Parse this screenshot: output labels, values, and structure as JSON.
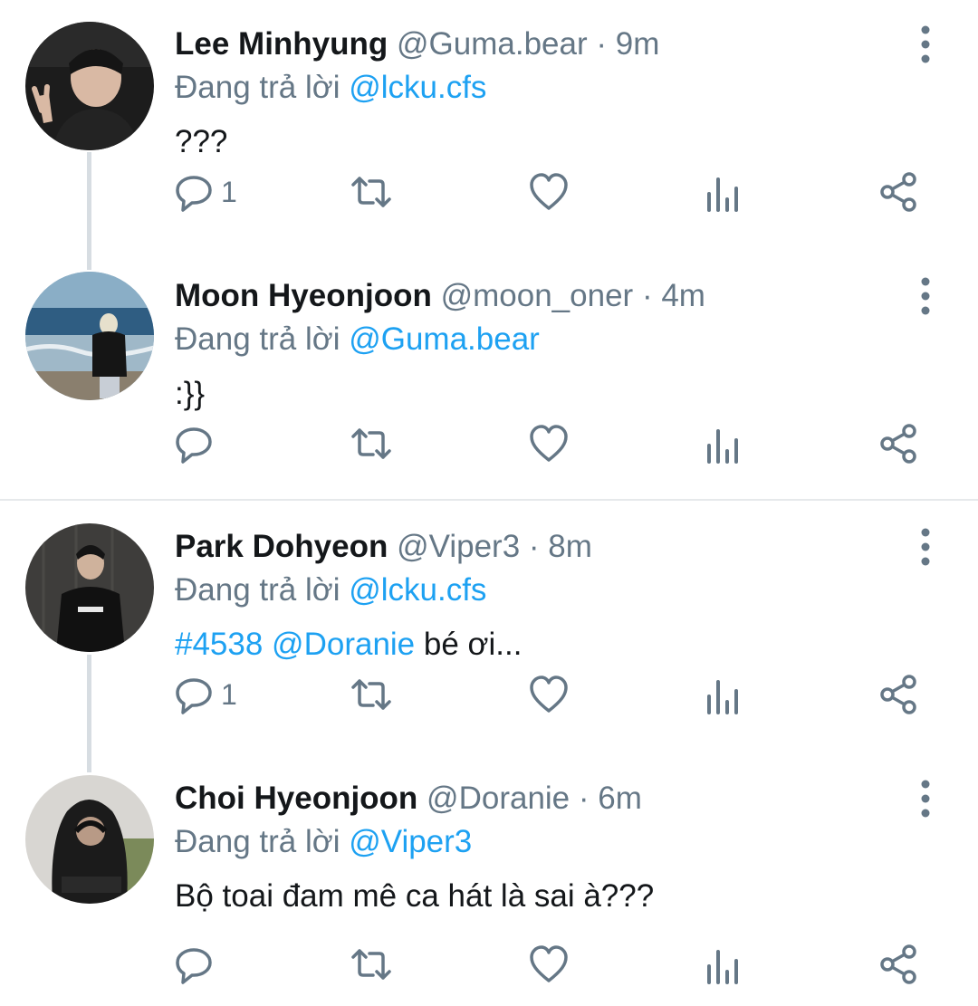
{
  "colors": {
    "accent": "#1da1f2",
    "muted": "#657786",
    "text": "#14171a",
    "thread_line": "#d7dde2"
  },
  "tweets": [
    {
      "name": "Lee Minhyung",
      "handle": "@Guma.bear",
      "separator": "·",
      "time": "9m",
      "reply_prefix": "Đang trả lời",
      "reply_to": "@lcku.cfs",
      "text": "???",
      "hashtag": "",
      "mention": "",
      "reply_count": "1",
      "avatar_icon": "portrait-photo"
    },
    {
      "name": "Moon Hyeonjoon",
      "handle": "@moon_oner",
      "separator": "·",
      "time": "4m",
      "reply_prefix": "Đang trả lời",
      "reply_to": "@Guma.bear",
      "text": ":}}",
      "hashtag": "",
      "mention": "",
      "reply_count": "",
      "avatar_icon": "beach-photo"
    },
    {
      "name": "Park Dohyeon",
      "handle": "@Viper3",
      "separator": "·",
      "time": "8m",
      "reply_prefix": "Đang trả lời",
      "reply_to": "@lcku.cfs",
      "text": " bé ơi...",
      "hashtag": "#4538",
      "mention": " @Doranie",
      "reply_count": "1",
      "avatar_icon": "portrait-photo"
    },
    {
      "name": "Choi Hyeonjoon",
      "handle": "@Doranie",
      "separator": "·",
      "time": "6m",
      "reply_prefix": "Đang trả lời",
      "reply_to": "@Viper3",
      "text": "Bộ toai đam mê ca hát là sai à???",
      "hashtag": "",
      "mention": "",
      "reply_count": "",
      "avatar_icon": "hoodie-photo"
    }
  ]
}
